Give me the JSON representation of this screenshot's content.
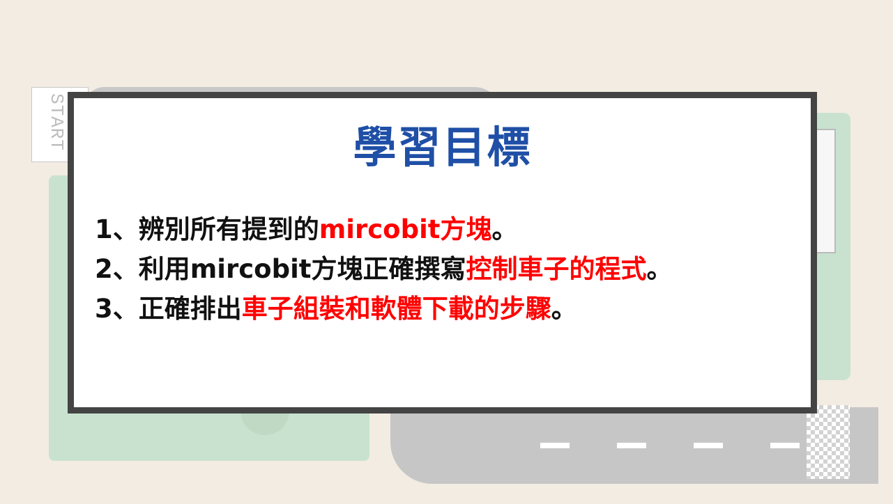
{
  "background": {
    "start_label": "START"
  },
  "card": {
    "title": "學習目標",
    "objectives": [
      {
        "number": "1",
        "sep": "、",
        "plain": "辨別所有提到的",
        "highlight": "mircobit方塊",
        "end": "。"
      },
      {
        "number": "2",
        "sep": "、",
        "plain": "利用mircobit方塊正確撰寫",
        "highlight": "控制車子的程式",
        "end": "。"
      },
      {
        "number": "3",
        "sep": "、",
        "plain": "正確排出",
        "highlight": "車子組裝和軟體下載的步驟",
        "end": "。"
      }
    ]
  },
  "colors": {
    "title": "#1f4fa6",
    "highlight": "#ff0000",
    "frame": "#444444",
    "background": "#f3ece2",
    "grass": "#c9e2d0",
    "road": "#c8c8c8"
  }
}
